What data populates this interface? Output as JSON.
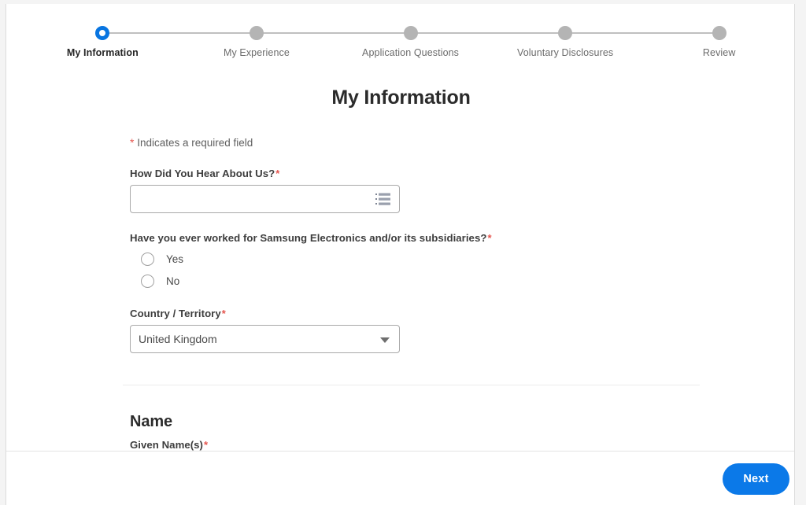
{
  "stepper": {
    "steps": [
      {
        "label": "My Information",
        "state": "active",
        "x_pct": 12.2
      },
      {
        "label": "My Experience",
        "state": "inactive",
        "x_pct": 31.7
      },
      {
        "label": "Application Questions",
        "state": "inactive",
        "x_pct": 51.2
      },
      {
        "label": "Voluntary Disclosures",
        "state": "inactive",
        "x_pct": 70.8
      },
      {
        "label": "Review",
        "state": "inactive",
        "x_pct": 90.3
      }
    ],
    "active_color": "#0875e1",
    "inactive_color": "#b4b4b4"
  },
  "page": {
    "title": "My Information",
    "required_note": "Indicates a required field",
    "required_marker": "*"
  },
  "fields": {
    "how_did_you_hear": {
      "label": "How Did You Hear About Us?",
      "required": "*",
      "value": "",
      "placeholder": "",
      "icon": "prompt-list-icon"
    },
    "worked_before": {
      "label": "Have you ever worked for Samsung Electronics and/or its subsidiaries?",
      "required": "*",
      "options": [
        {
          "label": "Yes",
          "selected": false
        },
        {
          "label": "No",
          "selected": false
        }
      ]
    },
    "country": {
      "label": "Country / Territory",
      "required": "*",
      "value": "United Kingdom",
      "icon": "chevron-down-icon"
    },
    "given_name": {
      "label": "Given Name(s)",
      "required": "*",
      "value": ""
    }
  },
  "sections": {
    "name_heading": "Name"
  },
  "footer": {
    "next_label": "Next",
    "next_color": "#0b79e8"
  }
}
